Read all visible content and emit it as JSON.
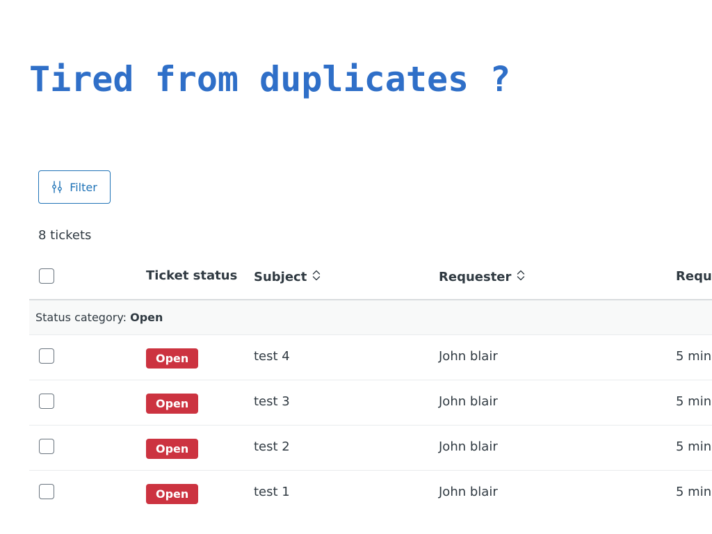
{
  "headline": "Tired from duplicates ?",
  "filter": {
    "label": "Filter",
    "icon": "sliders-icon"
  },
  "ticket_count": "8 tickets",
  "table": {
    "columns": {
      "status": "Ticket status",
      "subject": "Subject",
      "requester": "Requester",
      "requested": "Reque"
    },
    "group": {
      "prefix": "Status category:",
      "value": "Open"
    },
    "status_color": "#cc3340",
    "rows": [
      {
        "status": "Open",
        "subject": "test 4",
        "requester": "John blair",
        "requested": "5 min"
      },
      {
        "status": "Open",
        "subject": "test 3",
        "requester": "John blair",
        "requested": "5 min"
      },
      {
        "status": "Open",
        "subject": "test 2",
        "requester": "John blair",
        "requested": "5 min"
      },
      {
        "status": "Open",
        "subject": "test 1",
        "requester": "John blair",
        "requested": "5 min"
      }
    ]
  }
}
